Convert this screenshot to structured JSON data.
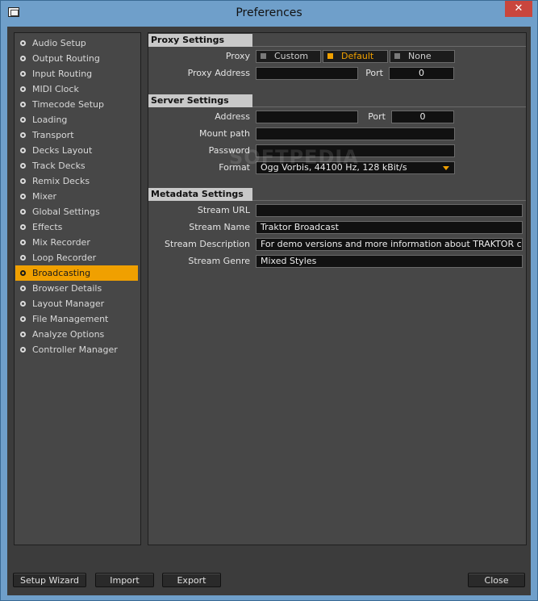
{
  "window": {
    "title": "Preferences",
    "close_glyph": "✕"
  },
  "sidebar": {
    "items": [
      {
        "label": "Audio Setup"
      },
      {
        "label": "Output Routing"
      },
      {
        "label": "Input Routing"
      },
      {
        "label": "MIDI Clock"
      },
      {
        "label": "Timecode Setup"
      },
      {
        "label": "Loading"
      },
      {
        "label": "Transport"
      },
      {
        "label": "Decks Layout"
      },
      {
        "label": "Track Decks"
      },
      {
        "label": "Remix Decks"
      },
      {
        "label": "Mixer"
      },
      {
        "label": "Global Settings"
      },
      {
        "label": "Effects"
      },
      {
        "label": "Mix Recorder"
      },
      {
        "label": "Loop Recorder"
      },
      {
        "label": "Broadcasting",
        "active": true
      },
      {
        "label": "Browser Details"
      },
      {
        "label": "Layout Manager"
      },
      {
        "label": "File Management"
      },
      {
        "label": "Analyze Options"
      },
      {
        "label": "Controller Manager"
      }
    ]
  },
  "proxy": {
    "section_title": "Proxy Settings",
    "proxy_label": "Proxy",
    "options": [
      "Custom",
      "Default",
      "None"
    ],
    "selected": "Default",
    "address_label": "Proxy Address",
    "address_value": "",
    "port_label": "Port",
    "port_value": "0"
  },
  "server": {
    "section_title": "Server Settings",
    "address_label": "Address",
    "address_value": "",
    "port_label": "Port",
    "port_value": "0",
    "mount_label": "Mount path",
    "mount_value": "",
    "password_label": "Password",
    "password_value": "",
    "format_label": "Format",
    "format_value": "Ogg Vorbis, 44100 Hz, 128 kBit/s"
  },
  "metadata": {
    "section_title": "Metadata Settings",
    "url_label": "Stream URL",
    "url_value": "",
    "name_label": "Stream Name",
    "name_value": "Traktor Broadcast",
    "desc_label": "Stream Description",
    "desc_value": "For demo versions and more information about TRAKTOR c",
    "genre_label": "Stream Genre",
    "genre_value": "Mixed Styles"
  },
  "footer": {
    "setup_wizard": "Setup Wizard",
    "import": "Import",
    "export": "Export",
    "close": "Close"
  },
  "watermark": "SOFTPEDIA",
  "colors": {
    "accent": "#f0a000",
    "panel": "#474747",
    "background": "#3c3c3c",
    "titlebar": "#6f9fca"
  }
}
